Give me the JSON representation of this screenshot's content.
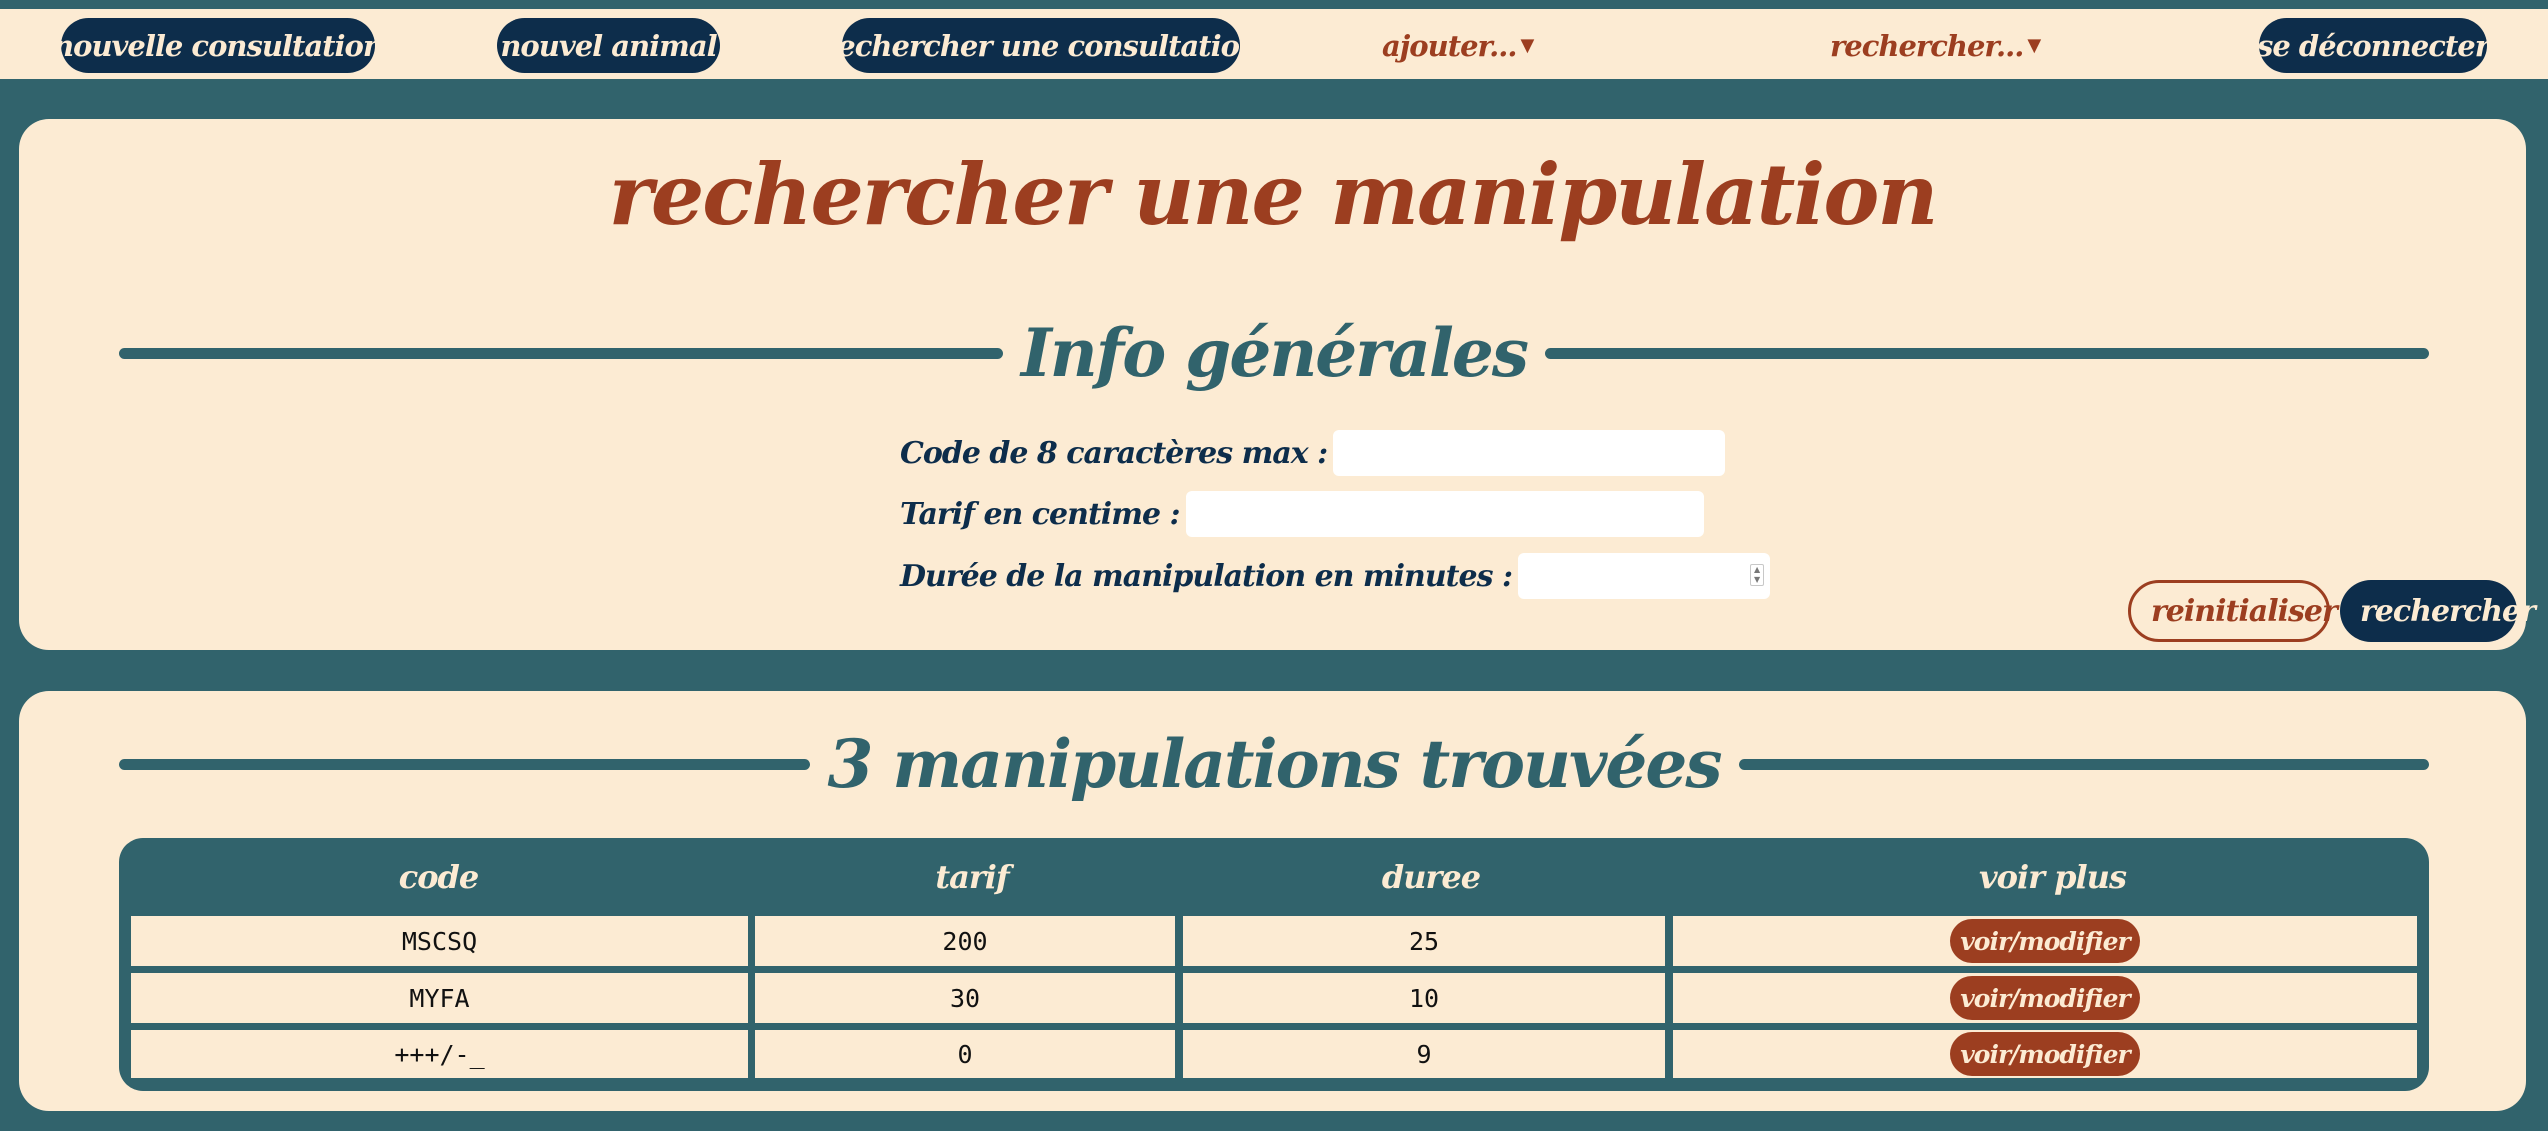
{
  "nav": {
    "new_consultation": "nouvelle consultation",
    "new_animal": "nouvel animal",
    "search_consultation": "rechercher une consultation",
    "add_menu": "ajouter...",
    "search_menu": "rechercher...",
    "logout": "se déconnecter"
  },
  "search_panel": {
    "title": "rechercher une manipulation",
    "section_heading": "Info générales",
    "fields": {
      "code_label": "Code de 8 caractères max :",
      "code_value": "",
      "tarif_label": "Tarif en centime :",
      "tarif_value": "",
      "duree_label": "Durée de la manipulation en minutes :",
      "duree_value": ""
    },
    "reset_label": "reinitialiser",
    "search_label": "rechercher"
  },
  "results": {
    "heading": "3 manipulations trouvées",
    "columns": [
      "code",
      "tarif",
      "duree",
      "voir plus"
    ],
    "rows": [
      {
        "code": "MSCSQ",
        "tarif": "200",
        "duree": "25",
        "action": "voir/modifier"
      },
      {
        "code": "MYFA",
        "tarif": "30",
        "duree": "10",
        "action": "voir/modifier"
      },
      {
        "code": "+++/-_",
        "tarif": "0",
        "duree": "9",
        "action": "voir/modifier"
      }
    ]
  },
  "colors": {
    "background": "#31636c",
    "panel": "#fcebd3",
    "navy": "#0d2d4b",
    "rust": "#9c3e20"
  },
  "icons": {
    "dropdown": "caret-down-icon",
    "spinner": "number-spinner-icon"
  }
}
